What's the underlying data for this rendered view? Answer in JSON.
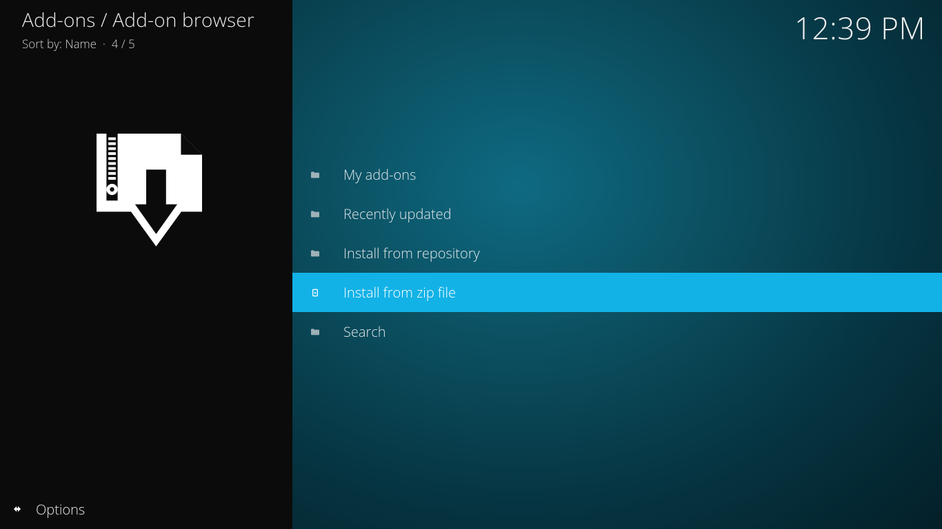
{
  "header": {
    "breadcrumb": "Add-ons / Add-on browser",
    "sort_label": "Sort by: Name",
    "separator": "·",
    "position": "4 / 5"
  },
  "clock": "12:39 PM",
  "list": {
    "items": [
      {
        "label": "My add-ons",
        "icon": "folder",
        "selected": false
      },
      {
        "label": "Recently updated",
        "icon": "folder",
        "selected": false
      },
      {
        "label": "Install from repository",
        "icon": "folder",
        "selected": false
      },
      {
        "label": "Install from zip file",
        "icon": "file",
        "selected": true
      },
      {
        "label": "Search",
        "icon": "folder",
        "selected": false
      }
    ]
  },
  "footer": {
    "options_label": "Options"
  }
}
